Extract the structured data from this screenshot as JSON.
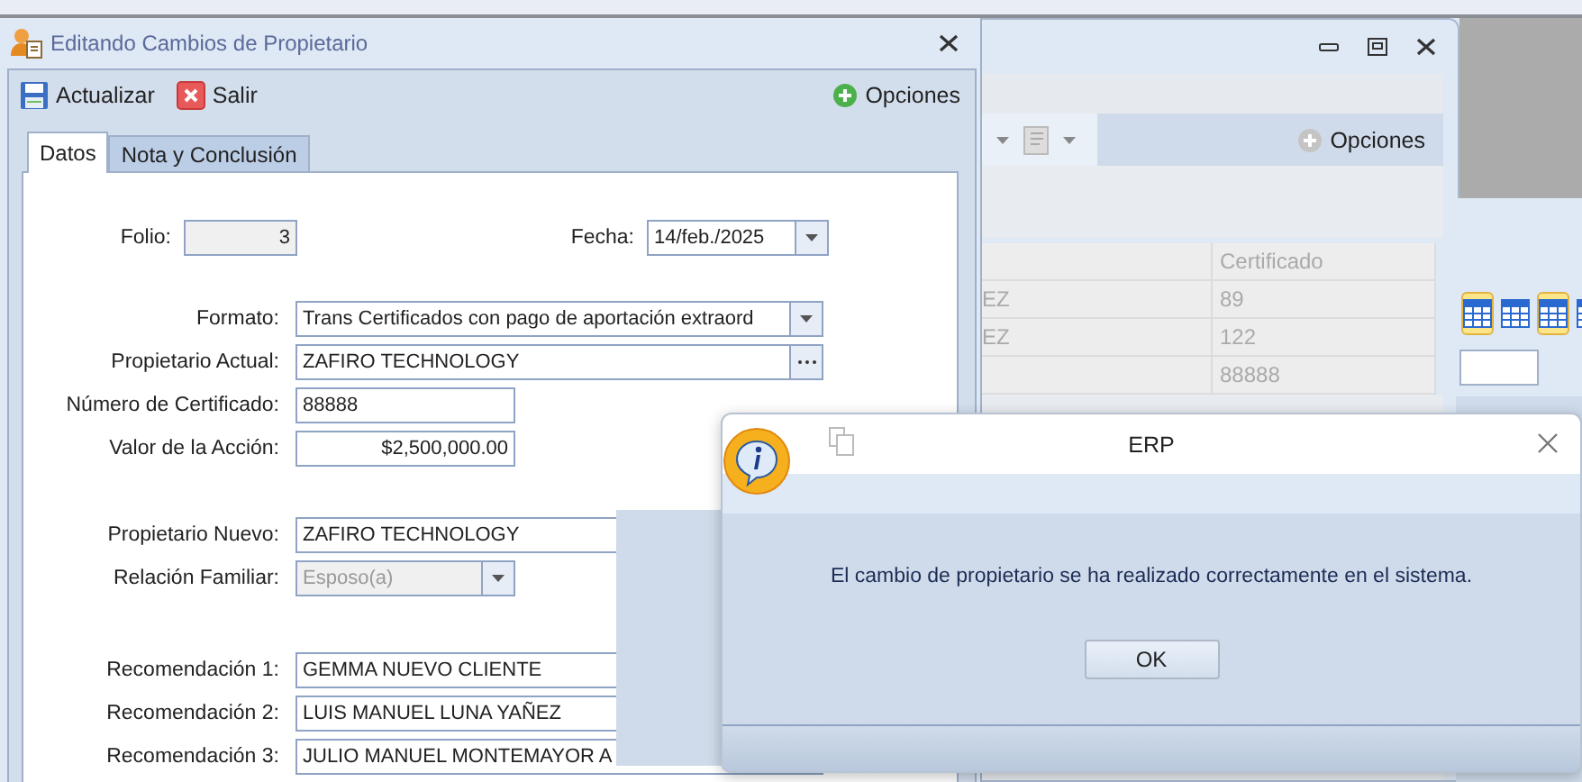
{
  "main_window": {
    "title": "Editando Cambios de Propietario",
    "toolbar": [
      {
        "kind": "save",
        "label": "Actualizar"
      },
      {
        "kind": "exit",
        "label": "Salir"
      }
    ],
    "options_label": "Opciones",
    "tabs": [
      {
        "label": "Datos",
        "selected": true
      },
      {
        "label": "Nota y Conclusión",
        "selected": false
      }
    ],
    "folio": {
      "label": "Folio:",
      "value": "3"
    },
    "fecha": {
      "label": "Fecha:",
      "value": "14/feb./2025"
    },
    "field_groups": [
      [
        {
          "kind": "wide_dropdown",
          "label": "Formato:",
          "value": "Trans Certificados con pago de aportación extraord",
          "disabled": false
        },
        {
          "kind": "lookup",
          "label": "Propietario Actual:",
          "value": "ZAFIRO TECHNOLOGY",
          "disabled": false
        },
        {
          "kind": "short_text",
          "label": "Número de Certificado:",
          "value": "88888",
          "disabled": false
        },
        {
          "kind": "amount",
          "label": "Valor de la Acción:",
          "value": "$2,500,000.00",
          "disabled": false
        }
      ],
      [
        {
          "kind": "wide_text",
          "label": "Propietario Nuevo:",
          "value": "ZAFIRO TECHNOLOGY",
          "disabled": false
        },
        {
          "kind": "short_dropdown",
          "label": "Relación Familiar:",
          "value": "Esposo(a)",
          "disabled": true
        }
      ],
      [
        {
          "kind": "wide_text",
          "label": "Recomendación 1:",
          "value": "GEMMA NUEVO CLIENTE",
          "disabled": false
        },
        {
          "kind": "wide_text",
          "label": "Recomendación 2:",
          "value": "LUIS MANUEL LUNA YAÑEZ",
          "disabled": false
        },
        {
          "kind": "wide_text",
          "label": "Recomendación 3:",
          "value": "JULIO MANUEL MONTEMAYOR A",
          "disabled": false
        }
      ]
    ]
  },
  "back_window": {
    "options_label": "Opciones",
    "table": {
      "column_2_header": "Certificado",
      "rows": [
        {
          "column_1": "EZ",
          "column_2": "89"
        },
        {
          "column_1": "EZ",
          "column_2": "122"
        },
        {
          "column_2": "88888"
        }
      ]
    }
  },
  "side_toolbar": [
    {
      "selected": true
    },
    {
      "selected": false
    },
    {
      "selected": true
    },
    {
      "selected": false
    }
  ],
  "dialog": {
    "title": "ERP",
    "message": "El cambio de propietario se ha realizado correctamente en el sistema.",
    "button": "OK"
  }
}
